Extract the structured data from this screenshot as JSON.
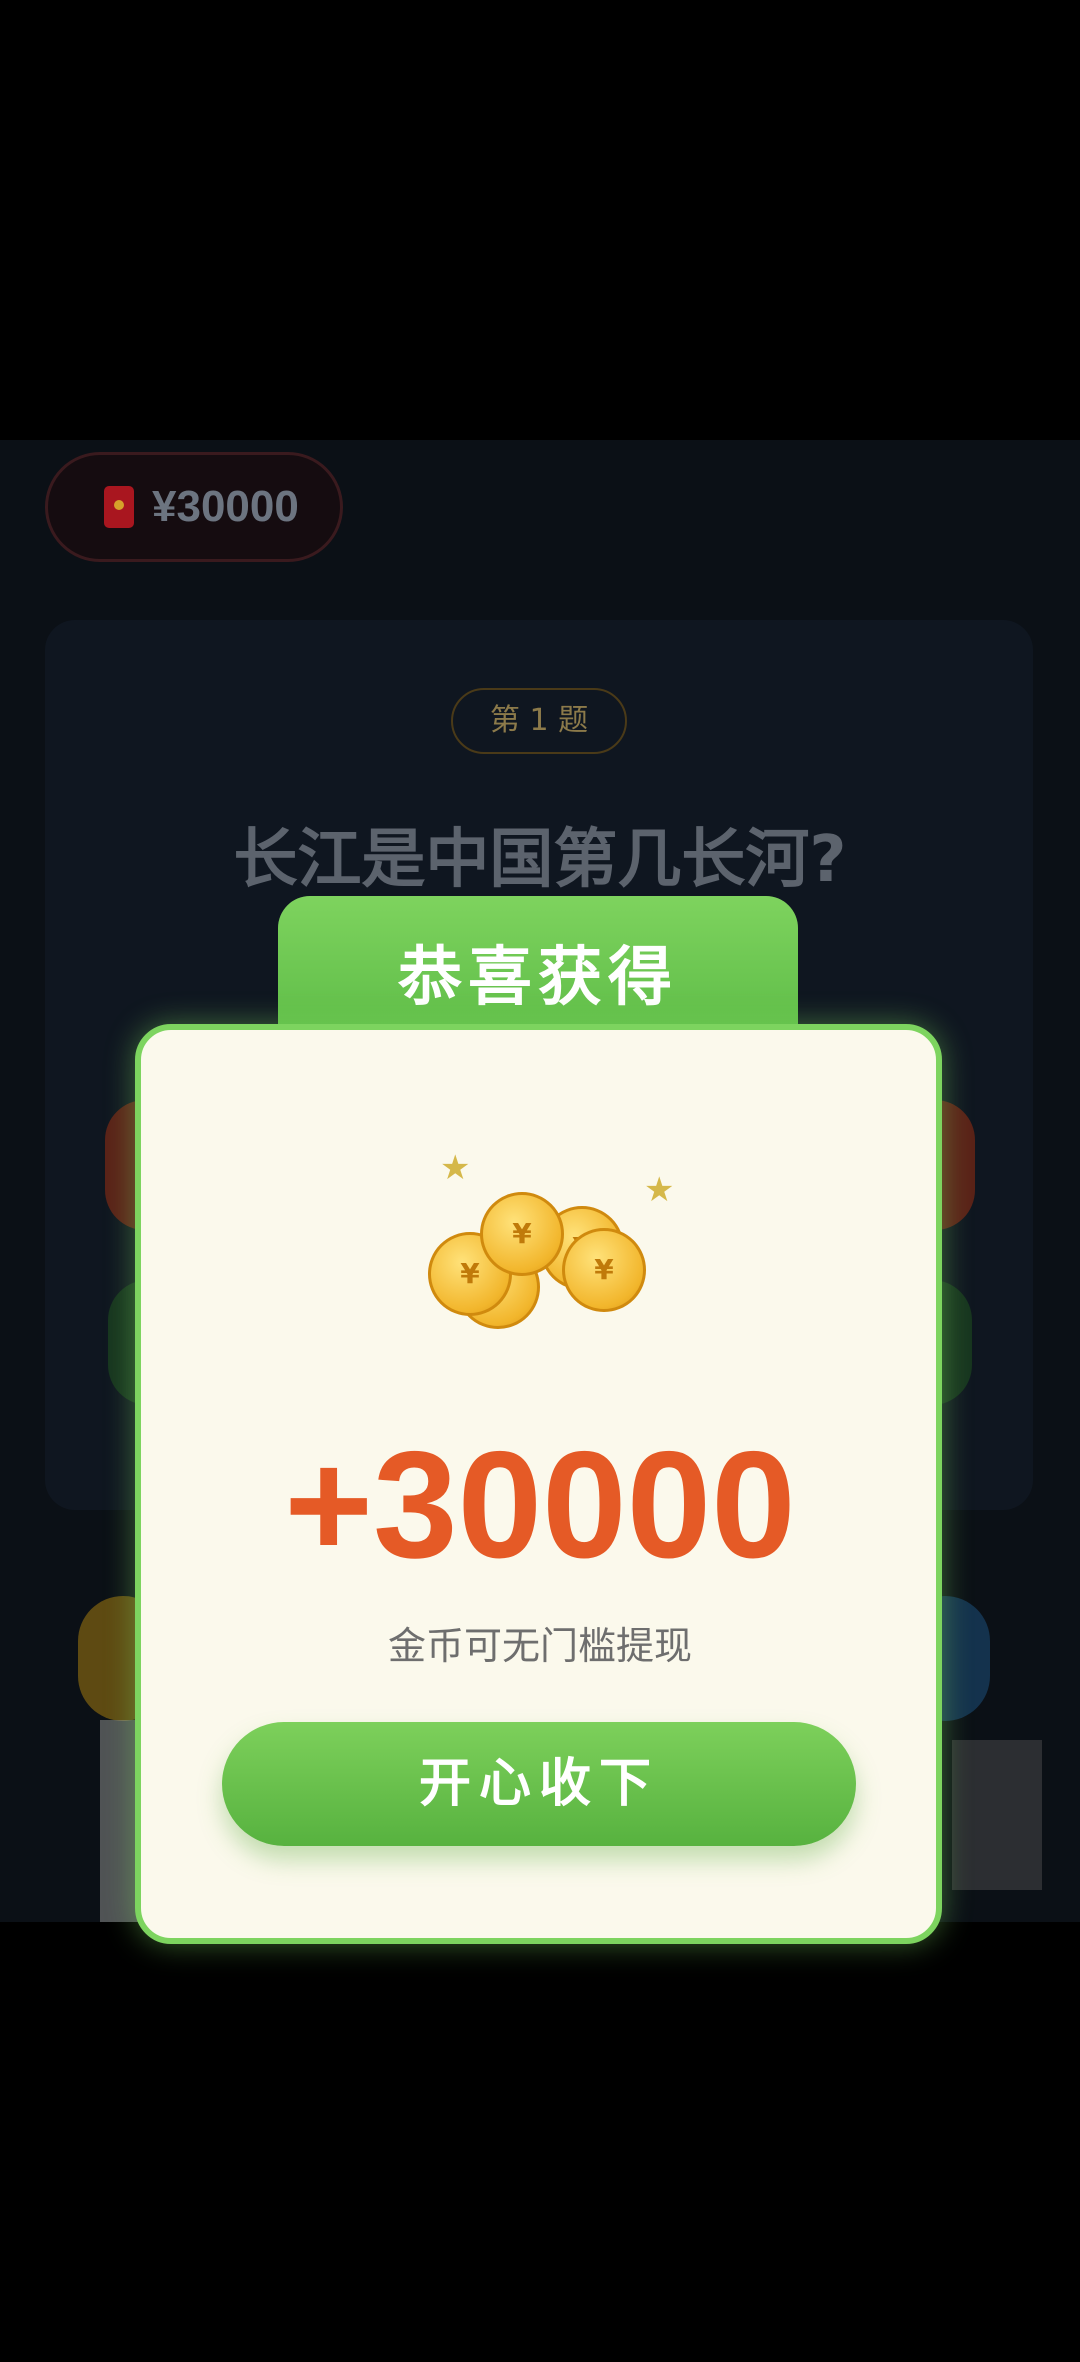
{
  "header": {
    "reward_amount": "¥30000"
  },
  "quiz": {
    "badge": "第 1 题",
    "question": "长江是中国第几长河?"
  },
  "modal": {
    "title": "恭喜获得",
    "amount": "+30000",
    "subtitle": "金币可无门槛提现",
    "button_label": "开心收下",
    "coin_symbol": "¥"
  },
  "colors": {
    "green": "#6cc84f",
    "orange_amount": "#e55a26",
    "background": "#0b1016"
  }
}
